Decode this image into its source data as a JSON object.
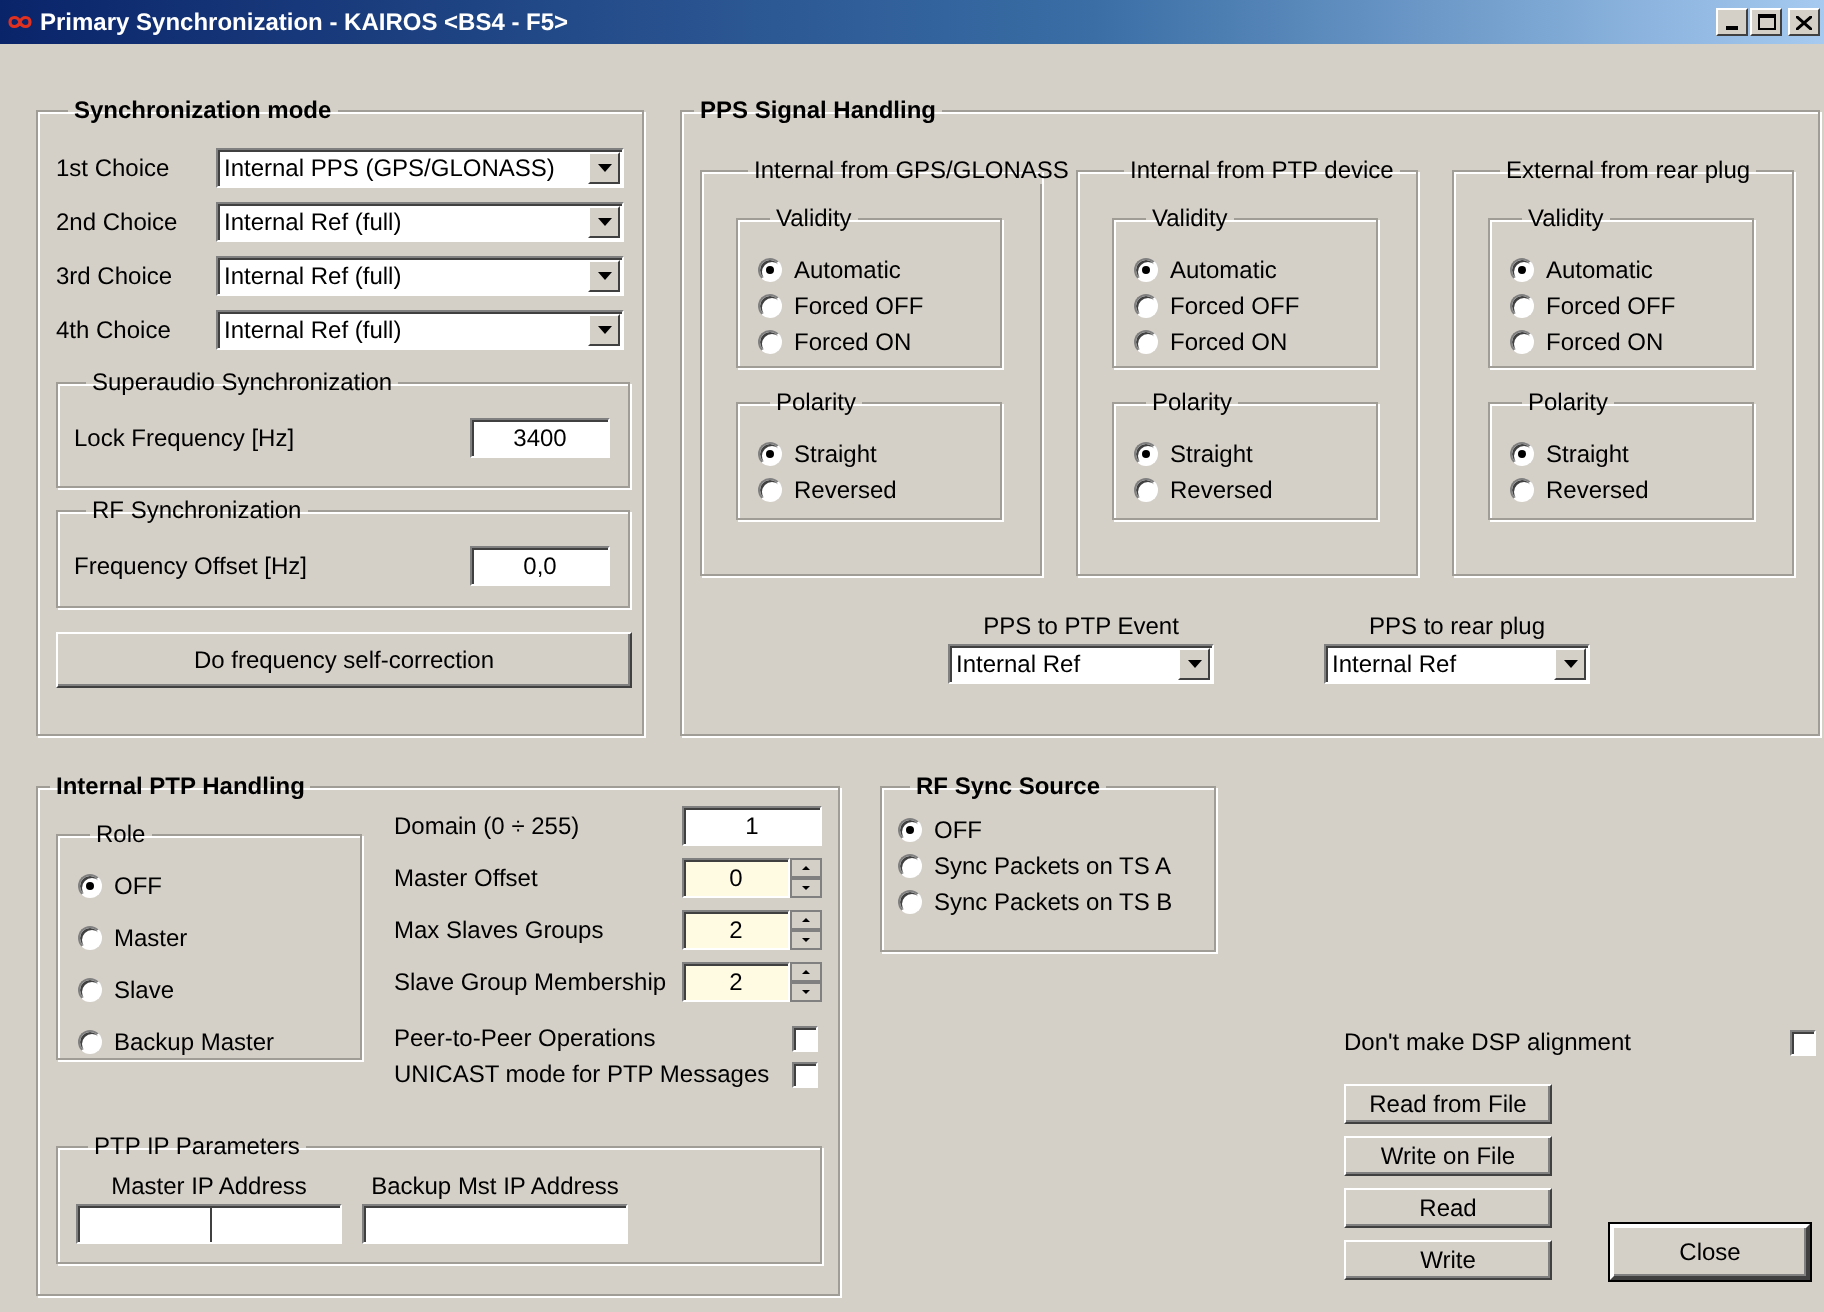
{
  "window": {
    "title": "Primary Synchronization - KAIROS <BS4 - F5>"
  },
  "sync_mode": {
    "title": "Synchronization mode",
    "choices": [
      {
        "label": "1st Choice",
        "value": "Internal PPS (GPS/GLONASS)"
      },
      {
        "label": "2nd Choice",
        "value": "Internal Ref (full)"
      },
      {
        "label": "3rd Choice",
        "value": "Internal Ref (full)"
      },
      {
        "label": "4th Choice",
        "value": "Internal Ref (full)"
      }
    ],
    "superaudio": {
      "title": "Superaudio Synchronization",
      "label": "Lock Frequency [Hz]",
      "value": "3400"
    },
    "rf_sync": {
      "title": "RF Synchronization",
      "label": "Frequency Offset [Hz]",
      "value": "0,0"
    },
    "button": "Do frequency self-correction"
  },
  "pps": {
    "title": "PPS Signal Handling",
    "sources": [
      {
        "title": "Internal from GPS/GLONASS",
        "validity": {
          "title": "Validity",
          "options": [
            {
              "label": "Automatic",
              "selected": true
            },
            {
              "label": "Forced OFF",
              "selected": false
            },
            {
              "label": "Forced ON",
              "selected": false
            }
          ]
        },
        "polarity": {
          "title": "Polarity",
          "options": [
            {
              "label": "Straight",
              "selected": true
            },
            {
              "label": "Reversed",
              "selected": false
            }
          ]
        }
      },
      {
        "title": "Internal from PTP device",
        "validity": {
          "title": "Validity",
          "options": [
            {
              "label": "Automatic",
              "selected": true
            },
            {
              "label": "Forced OFF",
              "selected": false
            },
            {
              "label": "Forced ON",
              "selected": false
            }
          ]
        },
        "polarity": {
          "title": "Polarity",
          "options": [
            {
              "label": "Straight",
              "selected": true
            },
            {
              "label": "Reversed",
              "selected": false
            }
          ]
        }
      },
      {
        "title": "External from rear plug",
        "validity": {
          "title": "Validity",
          "options": [
            {
              "label": "Automatic",
              "selected": true
            },
            {
              "label": "Forced OFF",
              "selected": false
            },
            {
              "label": "Forced ON",
              "selected": false
            }
          ]
        },
        "polarity": {
          "title": "Polarity",
          "options": [
            {
              "label": "Straight",
              "selected": true
            },
            {
              "label": "Reversed",
              "selected": false
            }
          ]
        }
      }
    ],
    "routes": [
      {
        "label": "PPS to PTP Event",
        "value": "Internal Ref"
      },
      {
        "label": "PPS to rear plug",
        "value": "Internal Ref"
      }
    ]
  },
  "ptp": {
    "title": "Internal PTP Handling",
    "role": {
      "title": "Role",
      "options": [
        {
          "label": "OFF",
          "selected": true
        },
        {
          "label": "Master",
          "selected": false
        },
        {
          "label": "Slave",
          "selected": false
        },
        {
          "label": "Backup Master",
          "selected": false
        }
      ]
    },
    "fields": [
      {
        "kind": "text",
        "label": "Domain (0 ÷ 255)",
        "value": "1"
      },
      {
        "kind": "spin",
        "label": "Master Offset",
        "value": "0"
      },
      {
        "kind": "spin",
        "label": "Max Slaves Groups",
        "value": "2"
      },
      {
        "kind": "spin",
        "label": "Slave Group Membership",
        "value": "2"
      }
    ],
    "checks": [
      {
        "label": "Peer-to-Peer Operations",
        "checked": false
      },
      {
        "label": "UNICAST mode for PTP Messages",
        "checked": false
      }
    ],
    "ip": {
      "title": "PTP IP Parameters",
      "fields": [
        {
          "label": "Master IP Address",
          "kind": "split"
        },
        {
          "label": "Backup Mst IP Address",
          "kind": "plain"
        }
      ]
    }
  },
  "rf_source": {
    "title": "RF Sync Source",
    "options": [
      {
        "label": "OFF",
        "selected": true
      },
      {
        "label": "Sync Packets on TS A",
        "selected": false
      },
      {
        "label": "Sync Packets on TS B",
        "selected": false
      }
    ]
  },
  "dsp": {
    "label": "Don't make DSP alignment",
    "checked": false
  },
  "buttons": [
    {
      "label": "Read from File",
      "default": false
    },
    {
      "label": "Write on File",
      "default": false
    },
    {
      "label": "Read",
      "default": false
    },
    {
      "label": "Write",
      "default": false
    }
  ],
  "close": {
    "label": "Close",
    "default": true
  }
}
